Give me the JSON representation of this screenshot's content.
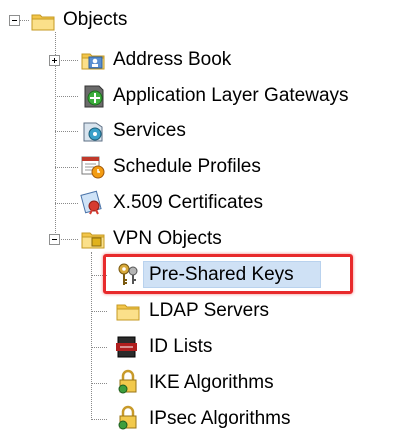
{
  "tree": {
    "root": {
      "label": "Objects",
      "icon": "folder-icon",
      "expanded": true
    },
    "items": [
      {
        "label": "Address Book",
        "icon": "address-book-icon",
        "expandable": true,
        "expanded": false
      },
      {
        "label": "Application Layer Gateways",
        "icon": "alg-icon",
        "expandable": false
      },
      {
        "label": "Services",
        "icon": "services-icon",
        "expandable": false
      },
      {
        "label": "Schedule Profiles",
        "icon": "calendar-clock-icon",
        "expandable": false
      },
      {
        "label": "X.509 Certificates",
        "icon": "certificate-icon",
        "expandable": false
      },
      {
        "label": "VPN Objects",
        "icon": "folder-icon",
        "expandable": true,
        "expanded": true
      }
    ],
    "vpn_children": [
      {
        "label": "Pre-Shared Keys",
        "icon": "keys-icon",
        "selected": true
      },
      {
        "label": "LDAP Servers",
        "icon": "folder-icon"
      },
      {
        "label": "ID Lists",
        "icon": "id-list-icon"
      },
      {
        "label": "IKE Algorithms",
        "icon": "lock-algorithm-icon"
      },
      {
        "label": "IPsec Algorithms",
        "icon": "lock-algorithm-icon"
      }
    ]
  },
  "colors": {
    "highlight_border": "#e8292b",
    "selection_bg": "#cfe1f5",
    "folder_yellow": "#f3c54a"
  }
}
